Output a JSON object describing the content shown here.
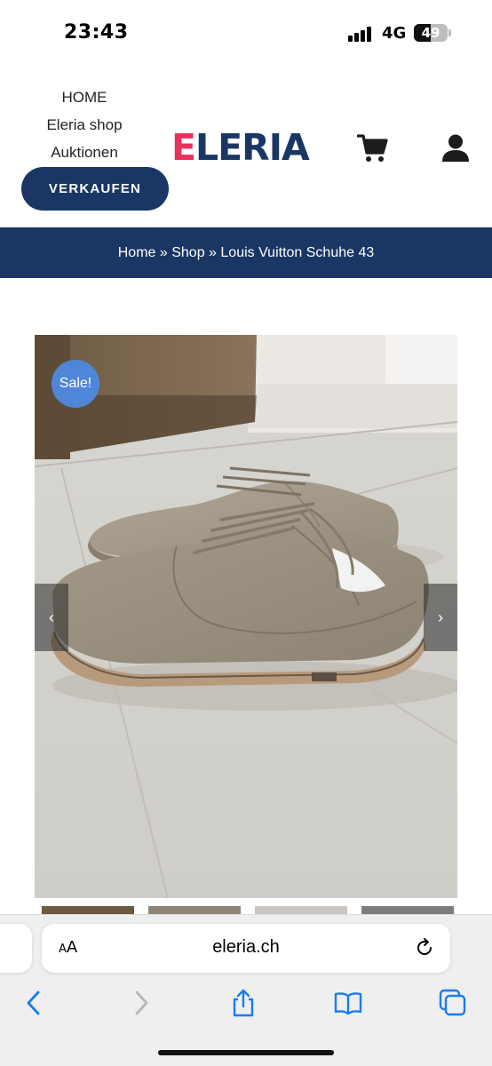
{
  "status_bar": {
    "time": "23:43",
    "network": "4G",
    "battery": "49",
    "battery_level": 0.49
  },
  "header": {
    "nav": [
      "HOME",
      "Eleria shop",
      "Auktionen"
    ],
    "sell_button": "VERKAUFEN",
    "logo_first": "E",
    "logo_rest": "LERIA",
    "icons": [
      "cart-icon",
      "user-icon"
    ]
  },
  "breadcrumb": {
    "home": "Home",
    "sep": " » ",
    "shop": "Shop",
    "current": "Louis Vuitton Schuhe 43"
  },
  "product": {
    "sale_badge": "Sale!",
    "prev_arrow": "‹",
    "next_arrow": "›"
  },
  "browser": {
    "reader_label_small": "A",
    "reader_label_large": "A",
    "url": "eleria.ch",
    "toolbar_icons": [
      "back-icon",
      "forward-icon",
      "share-icon",
      "bookmarks-icon",
      "tabs-icon"
    ]
  },
  "colors": {
    "brand_navy": "#1a3664",
    "brand_pink": "#e6325c",
    "sale_blue": "#4f86d8",
    "ios_blue": "#1a7cf0"
  }
}
